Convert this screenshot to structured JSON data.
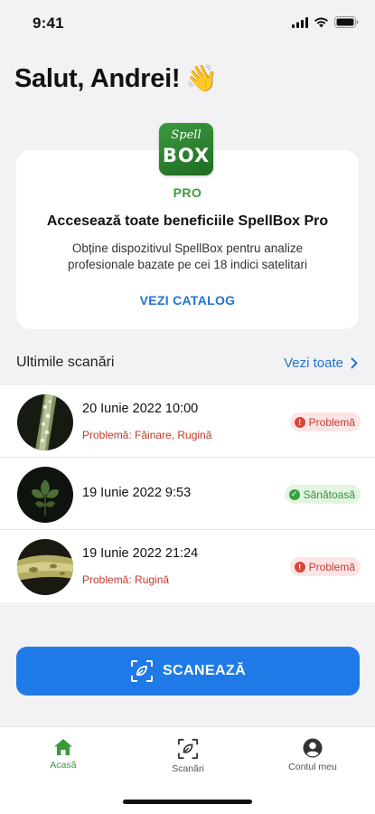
{
  "status_bar": {
    "time": "9:41"
  },
  "greeting": {
    "text": "Salut, Andrei!",
    "emoji": "👋"
  },
  "promo": {
    "logo_top": "Spell",
    "logo_bottom": "BOX",
    "tier": "PRO",
    "title": "Accesează toate beneficiile SpellBox Pro",
    "description": "Obține dispozitivul SpellBox pentru analize profesionale bazate pe cei 18 indici satelitari",
    "link_label": "VEZI CATALOG"
  },
  "recent": {
    "title": "Ultimile scanări",
    "see_all_label": "Vezi toate",
    "items": [
      {
        "date": "20 Iunie 2022 10:00",
        "problem": "Problemă: Făinare, Rugină",
        "status": "Problemă",
        "status_type": "bad"
      },
      {
        "date": "19 Iunie 2022 9:53",
        "problem": "",
        "status": "Sănătoasă",
        "status_type": "good"
      },
      {
        "date": "19 Iunie 2022 21:24",
        "problem": "Problemă: Rugină",
        "status": "Problemă",
        "status_type": "bad"
      }
    ]
  },
  "scan_button": {
    "label": "SCANEAZĂ"
  },
  "tabs": [
    {
      "label": "Acasă",
      "icon": "home-icon",
      "active": true
    },
    {
      "label": "Scanări",
      "icon": "scan-icon",
      "active": false
    },
    {
      "label": "Contul meu",
      "icon": "account-icon",
      "active": false
    }
  ],
  "colors": {
    "accent": "#1f7ae8",
    "brand_green": "#3a9a3a",
    "problem_red": "#c63a34",
    "healthy_green": "#34933a"
  }
}
